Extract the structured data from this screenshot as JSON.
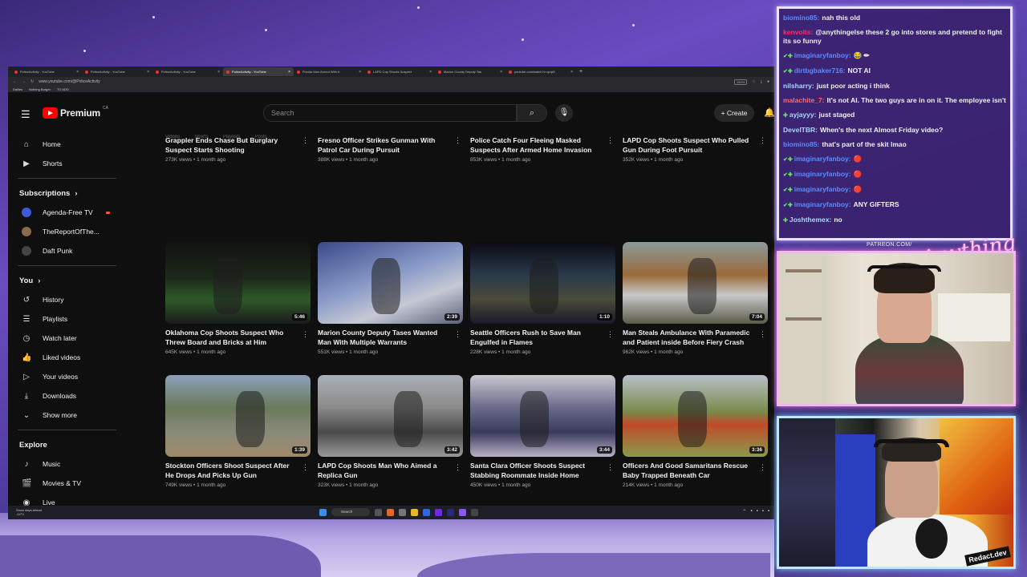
{
  "browser": {
    "tabs": [
      {
        "label": "PoliceActivity - YouTube",
        "active": false
      },
      {
        "label": "PoliceActivity - YouTube",
        "active": false
      },
      {
        "label": "PoliceActivity - YouTube",
        "active": false
      },
      {
        "label": "PoliceActivity - YouTube",
        "active": true
      },
      {
        "label": "Florida Man Armed With K",
        "active": false
      },
      {
        "label": "LAPD Cop Shoots Suspect",
        "active": false
      },
      {
        "label": "Marion County Deputy Tas",
        "active": false
      },
      {
        "label": "youtube.com/watch?v=qrqrD",
        "active": false
      }
    ],
    "url": "www.youtube.com/@PoliceActivity",
    "zoom": "150%",
    "bookmarks": [
      "Dailies",
      "Nothing Burger",
      "TO ADD"
    ]
  },
  "youtube": {
    "logo_text": "Premium",
    "region": "CA",
    "search_placeholder": "Search",
    "create_label": "Create",
    "chips": [
      "Videos",
      "Shorts",
      "Playlists",
      "Posts"
    ],
    "sidebar": {
      "main": [
        {
          "label": "Home",
          "icon": "home-icon",
          "glyph": "⌂"
        },
        {
          "label": "Shorts",
          "icon": "shorts-icon",
          "glyph": "▶"
        }
      ],
      "subscriptions_title": "Subscriptions",
      "subscriptions": [
        {
          "label": "Agenda-Free TV",
          "color": "#3b5bdb",
          "indicator": "live"
        },
        {
          "label": "TheReportOfThe...",
          "color": "#8a6a4a",
          "indicator": "new"
        },
        {
          "label": "Daft Punk",
          "color": "#444444",
          "indicator": ""
        }
      ],
      "you_title": "You",
      "you": [
        {
          "label": "History",
          "icon": "history-icon",
          "glyph": "↺"
        },
        {
          "label": "Playlists",
          "icon": "playlists-icon",
          "glyph": "☰"
        },
        {
          "label": "Watch later",
          "icon": "clock-icon",
          "glyph": "◷"
        },
        {
          "label": "Liked videos",
          "icon": "thumb-up-icon",
          "glyph": "👍"
        },
        {
          "label": "Your videos",
          "icon": "your-videos-icon",
          "glyph": "▷"
        },
        {
          "label": "Downloads",
          "icon": "download-icon",
          "glyph": "⤓"
        },
        {
          "label": "Show more",
          "icon": "chevron-down-icon",
          "glyph": "⌄"
        }
      ],
      "explore_title": "Explore",
      "explore": [
        {
          "label": "Music",
          "icon": "music-icon",
          "glyph": "♪"
        },
        {
          "label": "Movies & TV",
          "icon": "movies-icon",
          "glyph": "🎬"
        },
        {
          "label": "Live",
          "icon": "live-icon",
          "glyph": "◉"
        }
      ]
    },
    "partial_row": [
      {
        "title": "Grappler Ends Chase But Burglary Suspect Starts Shooting",
        "meta": "273K views • 1 month ago"
      },
      {
        "title": "Fresno Officer Strikes Gunman With Patrol Car During Pursuit",
        "meta": "388K views • 1 month ago"
      },
      {
        "title": "Police Catch Four Fleeing Masked Suspects After Armed Home Invasion",
        "meta": "853K views • 1 month ago"
      },
      {
        "title": "LAPD Cop Shoots Suspect Who Pulled Gun During Foot Pursuit",
        "meta": "352K views • 1 month ago"
      }
    ],
    "videos": [
      {
        "title": "Oklahoma Cop Shoots Suspect Who Threw Board and Bricks at Him",
        "meta": "645K views • 1 month ago",
        "duration": "5:46"
      },
      {
        "title": "Marion County Deputy Tases Wanted Man With Multiple Warrants",
        "meta": "551K views • 1 month ago",
        "duration": "2:39"
      },
      {
        "title": "Seattle Officers Rush to Save Man Engulfed in Flames",
        "meta": "228K views • 1 month ago",
        "duration": "1:10"
      },
      {
        "title": "Man Steals Ambulance With Paramedic and Patient inside Before Fiery Crash",
        "meta": "962K views • 1 month ago",
        "duration": "7:04"
      },
      {
        "title": "Stockton Officers Shoot Suspect After He Drops And Picks Up Gun",
        "meta": "749K views • 1 month ago",
        "duration": "1:39"
      },
      {
        "title": "LAPD Cop Shoots Man Who Aimed a Replica Gun",
        "meta": "323K views • 1 month ago",
        "duration": "3:42"
      },
      {
        "title": "Santa Clara Officer Shoots Suspect Stabbing Roommate Inside Home",
        "meta": "450K views • 1 month ago",
        "duration": "3:44"
      },
      {
        "title": "Officers And Good Samaritans Rescue Baby Trapped Beneath Car",
        "meta": "214K views • 1 month ago",
        "duration": "3:36"
      }
    ]
  },
  "taskbar": {
    "weather": "Snow days ahead",
    "temp": "-14°C",
    "search": "Search"
  },
  "chat": {
    "messages": [
      {
        "user": "biomino85:",
        "text": "nah this old",
        "color": "#5b8cff",
        "badges": ""
      },
      {
        "user": "kenvolts:",
        "text": "@anythingelse these 2 go into stores and pretend to fight its so funny",
        "color": "#ff2d55",
        "badges": ""
      },
      {
        "user": "imaginaryfanboy:",
        "text": "😂 ✏",
        "color": "#5b8cff",
        "badges": "✔✚"
      },
      {
        "user": "dirtbgbaker716:",
        "text": "NOT AI",
        "color": "#5b8cff",
        "badges": "✔✚"
      },
      {
        "user": "nilsharry:",
        "text": "just poor acting i think",
        "color": "#a8d8ff",
        "badges": ""
      },
      {
        "user": "malachite_7:",
        "text": "It's not AI. The two guys are in on it. The employee isn't",
        "color": "#ff6a6a",
        "badges": ""
      },
      {
        "user": "ayjayyy:",
        "text": "just staged",
        "color": "#a8d8ff",
        "badges": "✚"
      },
      {
        "user": "DevelTBR:",
        "text": "When's the next Almost Friday video?",
        "color": "#a8d8ff",
        "badges": ""
      },
      {
        "user": "biomino85:",
        "text": "that's part of the skit lmao",
        "color": "#5b8cff",
        "badges": ""
      },
      {
        "user": "imaginaryfanboy:",
        "text": "🔴",
        "color": "#5b8cff",
        "badges": "✔✚"
      },
      {
        "user": "imaginaryfanboy:",
        "text": "🔴",
        "color": "#5b8cff",
        "badges": "✔✚"
      },
      {
        "user": "imaginaryfanboy:",
        "text": "🔴",
        "color": "#5b8cff",
        "badges": "✔✚"
      },
      {
        "user": "imaginaryfanboy:",
        "text": "ANY GIFTERS",
        "color": "#5b8cff",
        "badges": "✔✚"
      },
      {
        "user": "Joshthemex:",
        "text": "no",
        "color": "#a8d8ff",
        "badges": "✚"
      }
    ]
  },
  "overlay": {
    "patreon": "PATREON.COM/",
    "signature": "Anything Else?",
    "watermark": "Redact.dev"
  }
}
